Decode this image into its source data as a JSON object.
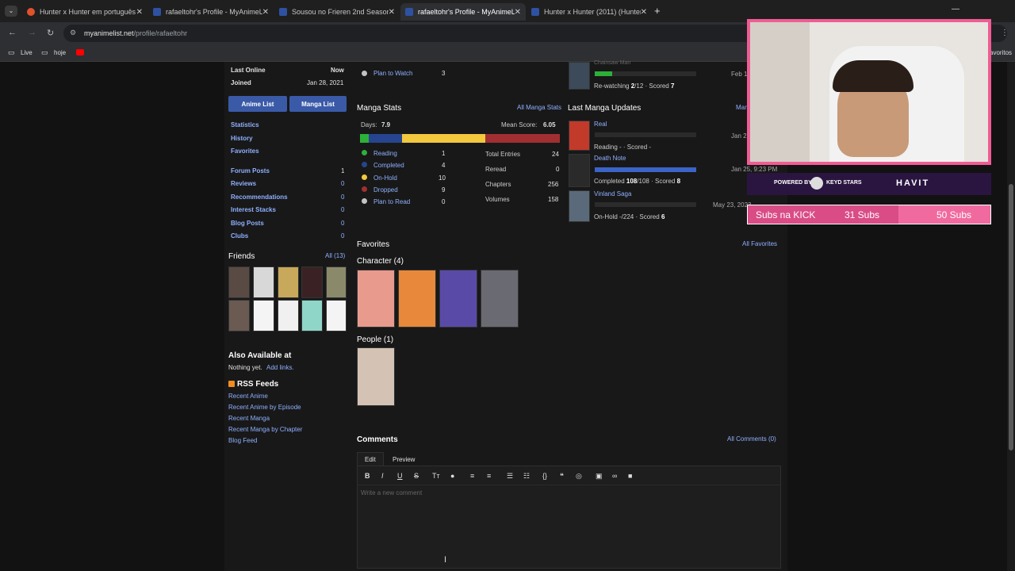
{
  "browser": {
    "tabs": [
      {
        "title": "Hunter x Hunter em português",
        "active": false
      },
      {
        "title": "rafaeltohr's Profile - MyAnimeL",
        "active": false
      },
      {
        "title": "Sousou no Frieren 2nd Season",
        "active": false
      },
      {
        "title": "rafaeltohr's Profile - MyAnimeL",
        "active": true
      },
      {
        "title": "Hunter x Hunter (2011) (Hunter",
        "active": false
      }
    ],
    "url_host": "myanimelist.net",
    "url_path": "/profile/rafaeltohr",
    "bookmarks": [
      {
        "label": "Live"
      },
      {
        "label": "hoje"
      }
    ],
    "bookmarks_right": "avoritos"
  },
  "sidebar": {
    "last_online_label": "Last Online",
    "last_online_value": "Now",
    "joined_label": "Joined",
    "joined_value": "Jan 28, 2021",
    "anime_list_btn": "Anime List",
    "manga_list_btn": "Manga List",
    "links": [
      "Statistics",
      "History",
      "Favorites"
    ],
    "counts": [
      {
        "label": "Forum Posts",
        "value": "1"
      },
      {
        "label": "Reviews",
        "value": "0"
      },
      {
        "label": "Recommendations",
        "value": "0"
      },
      {
        "label": "Interest Stacks",
        "value": "0"
      },
      {
        "label": "Blog Posts",
        "value": "0"
      },
      {
        "label": "Clubs",
        "value": "0"
      }
    ],
    "friends_title": "Friends",
    "friends_all": "All (13)",
    "also_available_title": "Also Available at",
    "also_available_text": "Nothing yet.",
    "also_available_link": "Add links.",
    "rss_title": "RSS Feeds",
    "rss_links": [
      "Recent Anime",
      "Recent Anime by Episode",
      "Recent Manga",
      "Recent Manga by Chapter",
      "Blog Feed"
    ]
  },
  "anime_stats_tail": {
    "plan_to_watch_label": "Plan to Watch",
    "plan_to_watch_value": "3"
  },
  "manga_stats": {
    "title": "Manga Stats",
    "all_link": "All Manga Stats",
    "days_label": "Days:",
    "days_value": "7.9",
    "mean_label": "Mean Score:",
    "mean_value": "6.05",
    "status": [
      {
        "label": "Reading",
        "value": "1",
        "color": "#2db039"
      },
      {
        "label": "Completed",
        "value": "4",
        "color": "#26448f"
      },
      {
        "label": "On-Hold",
        "value": "10",
        "color": "#f1c83e"
      },
      {
        "label": "Dropped",
        "value": "9",
        "color": "#a12f31"
      },
      {
        "label": "Plan to Read",
        "value": "0",
        "color": "#c3c3c3"
      }
    ],
    "totals": [
      {
        "label": "Total Entries",
        "value": "24"
      },
      {
        "label": "Reread",
        "value": "0"
      },
      {
        "label": "Chapters",
        "value": "256"
      },
      {
        "label": "Volumes",
        "value": "158"
      }
    ]
  },
  "anime_updates_tail": {
    "title_partial": "Chainsaw Man",
    "status": "Re-watching",
    "progress": "2",
    "total": "/12",
    "scored_label": "· Scored",
    "score": "7",
    "date": "Feb 1",
    "progress_fraction": 0.17
  },
  "manga_updates": {
    "title": "Last Manga Updates",
    "all_partial": "Man",
    "items": [
      {
        "title": "Real",
        "line": "Reading - · Scored -",
        "date": "Jan 2",
        "progress_fraction": 0,
        "color": "#2db039"
      },
      {
        "title": "Death Note",
        "status": "Completed",
        "progress": "108",
        "total": "/108",
        "scored": "· Scored",
        "score": "8",
        "date": "Jan 25, 9:23 PM",
        "progress_fraction": 1.0,
        "color": "#26448f"
      },
      {
        "title": "Vinland Saga",
        "line": "On-Hold -/224 · Scored",
        "score": "6",
        "date": "May 23, 2023",
        "progress_fraction": 0,
        "color": "#f1c83e"
      }
    ]
  },
  "favorites": {
    "title": "Favorites",
    "all_link": "All Favorites",
    "character_title": "Character (4)",
    "people_title": "People (1)"
  },
  "comments": {
    "title": "Comments",
    "all_link": "All Comments (0)",
    "tab_edit": "Edit",
    "tab_preview": "Preview",
    "placeholder": "Write a new comment"
  },
  "overlay": {
    "powered_by": "POWERED BY",
    "sponsor1": "KEYD STARS",
    "sponsor2": "HAVIT",
    "subs_label": "Subs na KICK",
    "subs_current": "31 Subs",
    "subs_goal": "50 Subs",
    "subs_fraction": 0.62
  }
}
